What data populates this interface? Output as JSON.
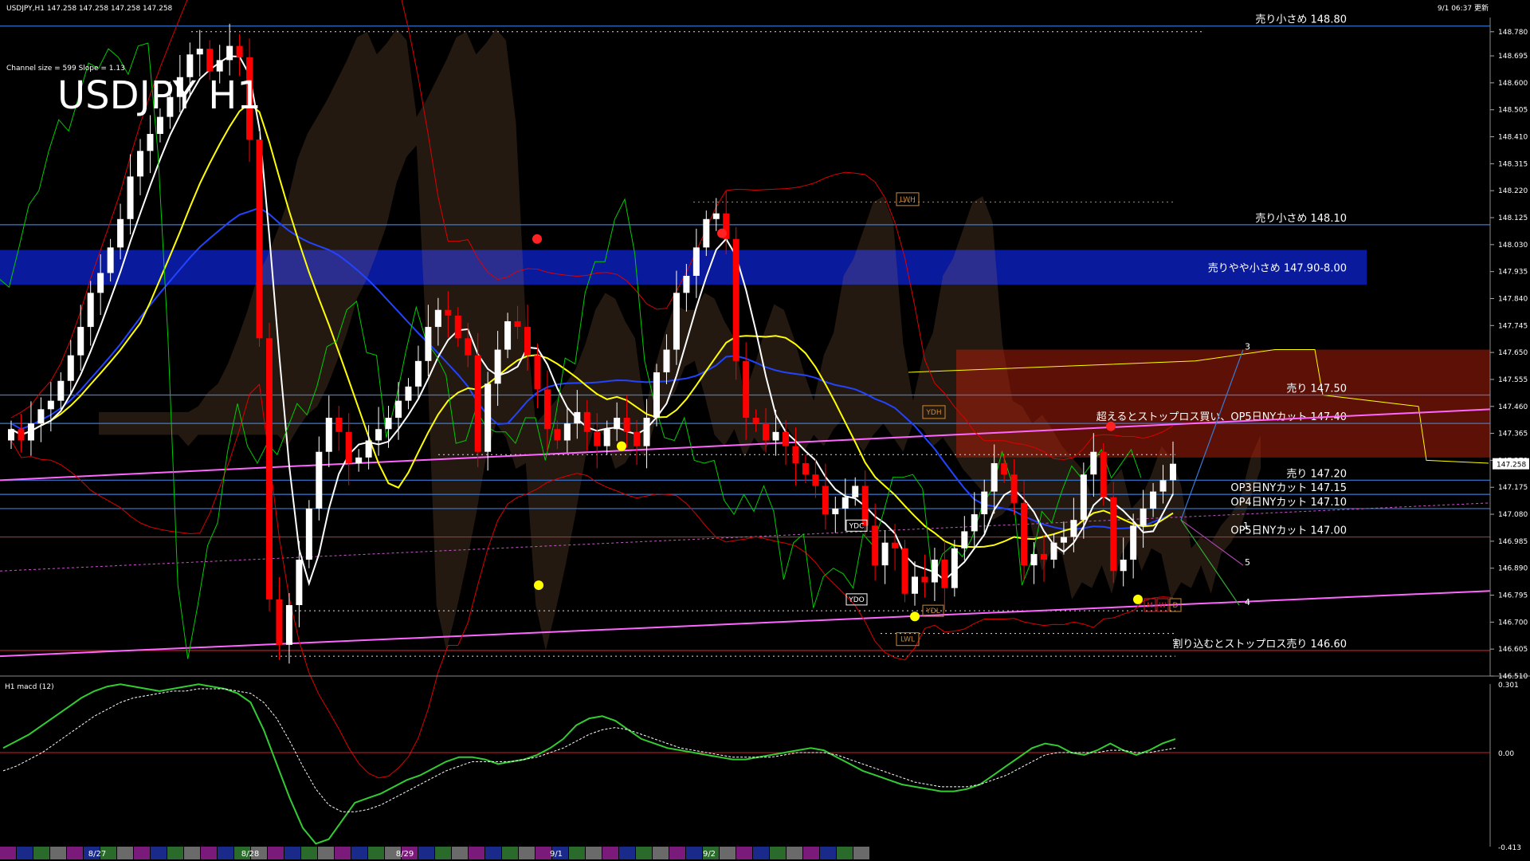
{
  "header": {
    "symbol_line": "USDJPY,H1  147.258 147.258 147.258 147.258",
    "datetime": "9/1 06:37 更新",
    "channel_info": "Channel size = 599 Slope = 1.13",
    "big_title": "USDJPY H1"
  },
  "colors": {
    "background": "#000000",
    "bull_candle": "#ffffff",
    "bear_candle": "#ff0000",
    "level_line": "#3a7bd5",
    "sell_zone": "#0a1a9c",
    "channel_line": "#ff66ff",
    "macd_main": "#33cc33",
    "macd_signal": "#ffffff",
    "ma_white": "#ffffff",
    "ma_yellow": "#ffff00",
    "ma_blue": "#2244ff",
    "ichimoku_green": "#00cc00",
    "bollinger_red": "#dd0000"
  },
  "chart_data": {
    "type": "candlestick",
    "symbol": "USDJPY",
    "timeframe": "H1",
    "ylim": [
      146.51,
      148.83
    ],
    "y_ticks": [
      148.78,
      148.695,
      148.6,
      148.505,
      148.41,
      148.315,
      148.22,
      148.125,
      148.03,
      147.935,
      147.84,
      147.745,
      147.65,
      147.555,
      147.46,
      147.365,
      147.27,
      147.175,
      147.08,
      146.985,
      146.89,
      146.795,
      146.7,
      146.605,
      146.51
    ],
    "y_tick_labels": [
      "148.780",
      "148.695",
      "148.600",
      "148.505",
      "148.410",
      "148.315",
      "148.220",
      "148.125",
      "148.030",
      "147.935",
      "147.840",
      "147.745",
      "147.650",
      "147.555",
      "147.460",
      "147.365",
      "147.270",
      "147.175",
      "147.080",
      "146.985",
      "146.890",
      "146.795",
      "146.700",
      "146.605",
      "146.510"
    ],
    "current_price": "147.258",
    "date_labels": [
      "8/27",
      "8/28",
      "8/29",
      "9/1",
      "9/2"
    ],
    "closes": [
      147.38,
      147.34,
      147.4,
      147.45,
      147.48,
      147.55,
      147.64,
      147.74,
      147.86,
      147.93,
      148.02,
      148.12,
      148.27,
      148.36,
      148.42,
      148.48,
      148.55,
      148.62,
      148.7,
      148.72,
      148.64,
      148.68,
      148.73,
      148.69,
      148.4,
      147.7,
      146.78,
      146.62,
      146.76,
      146.92,
      147.1,
      147.3,
      147.42,
      147.37,
      147.26,
      147.28,
      147.34,
      147.38,
      147.42,
      147.48,
      147.53,
      147.62,
      147.74,
      147.8,
      147.78,
      147.7,
      147.64,
      147.3,
      147.54,
      147.66,
      147.76,
      147.74,
      147.64,
      147.52,
      147.38,
      147.34,
      147.4,
      147.44,
      147.37,
      147.32,
      147.38,
      147.42,
      147.37,
      147.32,
      147.42,
      147.58,
      147.66,
      147.86,
      147.92,
      148.02,
      148.12,
      148.14,
      148.05,
      147.62,
      147.42,
      147.4,
      147.34,
      147.37,
      147.32,
      147.26,
      147.22,
      147.18,
      147.08,
      147.1,
      147.14,
      147.18,
      147.04,
      146.9,
      146.98,
      146.96,
      146.8,
      146.86,
      146.84,
      146.92,
      146.82,
      146.96,
      147.02,
      147.08,
      147.16,
      147.26,
      147.22,
      147.12,
      146.9,
      146.94,
      146.92,
      146.98,
      147.0,
      147.06,
      147.22,
      147.3,
      147.14,
      146.88,
      146.92,
      147.04,
      147.1,
      147.16,
      147.2,
      147.258
    ],
    "levels": [
      {
        "label": "売り小さめ 148.80",
        "price": 148.8
      },
      {
        "label": "売り小さめ 148.10",
        "price": 148.1
      },
      {
        "label": "売りやや小さめ 147.90-8.00",
        "price_low": 147.9,
        "price_high": 148.0,
        "zone": true
      },
      {
        "label": "売り 147.50",
        "price": 147.5
      },
      {
        "label": "超えるとストップロス買い、OP5日NYカット 147.40",
        "price": 147.4
      },
      {
        "label": "売り 147.20",
        "price": 147.2
      },
      {
        "label": "OP3日NYカット 147.15",
        "price": 147.15
      },
      {
        "label": "OP4日NYカット 147.10",
        "price": 147.1
      },
      {
        "label": "OP5日NYカット 147.00",
        "price": 147.0
      },
      {
        "label": "割り込むとストップロス売り 146.60",
        "price": 146.6
      }
    ],
    "markers": [
      "LWH",
      "YDH",
      "YDC",
      "YDO",
      "YDL",
      "LWL",
      "M",
      "W",
      "D",
      "3",
      "1",
      "5",
      "4"
    ],
    "indicator": {
      "name": "H1  macd (12)",
      "y_tick_labels": [
        "0.301",
        "0.00",
        "-0.413"
      ],
      "main": [
        0.02,
        0.05,
        0.08,
        0.12,
        0.16,
        0.2,
        0.24,
        0.27,
        0.29,
        0.3,
        0.29,
        0.28,
        0.27,
        0.28,
        0.29,
        0.3,
        0.29,
        0.28,
        0.26,
        0.22,
        0.1,
        -0.05,
        -0.2,
        -0.33,
        -0.4,
        -0.38,
        -0.3,
        -0.22,
        -0.2,
        -0.18,
        -0.15,
        -0.12,
        -0.1,
        -0.07,
        -0.04,
        -0.02,
        -0.02,
        -0.03,
        -0.05,
        -0.04,
        -0.03,
        -0.01,
        0.02,
        0.06,
        0.12,
        0.15,
        0.16,
        0.14,
        0.1,
        0.06,
        0.04,
        0.02,
        0.01,
        0.0,
        -0.01,
        -0.02,
        -0.03,
        -0.03,
        -0.02,
        -0.01,
        0.0,
        0.01,
        0.02,
        0.01,
        -0.02,
        -0.05,
        -0.08,
        -0.1,
        -0.12,
        -0.14,
        -0.15,
        -0.16,
        -0.17,
        -0.17,
        -0.16,
        -0.14,
        -0.1,
        -0.06,
        -0.02,
        0.02,
        0.04,
        0.03,
        0.0,
        -0.01,
        0.01,
        0.04,
        0.01,
        -0.01,
        0.01,
        0.04,
        0.06
      ],
      "signal": [
        -0.08,
        -0.06,
        -0.03,
        0.0,
        0.04,
        0.08,
        0.12,
        0.16,
        0.19,
        0.22,
        0.24,
        0.25,
        0.26,
        0.27,
        0.27,
        0.28,
        0.28,
        0.28,
        0.27,
        0.26,
        0.22,
        0.15,
        0.05,
        -0.06,
        -0.16,
        -0.23,
        -0.26,
        -0.26,
        -0.25,
        -0.23,
        -0.2,
        -0.17,
        -0.14,
        -0.11,
        -0.08,
        -0.06,
        -0.04,
        -0.04,
        -0.04,
        -0.04,
        -0.03,
        -0.02,
        0.0,
        0.02,
        0.05,
        0.08,
        0.1,
        0.11,
        0.1,
        0.08,
        0.06,
        0.04,
        0.02,
        0.01,
        0.0,
        -0.01,
        -0.02,
        -0.02,
        -0.02,
        -0.02,
        -0.01,
        0.0,
        0.0,
        0.0,
        -0.01,
        -0.03,
        -0.05,
        -0.07,
        -0.09,
        -0.11,
        -0.13,
        -0.14,
        -0.15,
        -0.15,
        -0.15,
        -0.14,
        -0.12,
        -0.1,
        -0.07,
        -0.04,
        -0.01,
        0.0,
        0.0,
        0.0,
        0.0,
        0.01,
        0.01,
        0.0,
        0.0,
        0.01,
        0.02
      ]
    }
  }
}
